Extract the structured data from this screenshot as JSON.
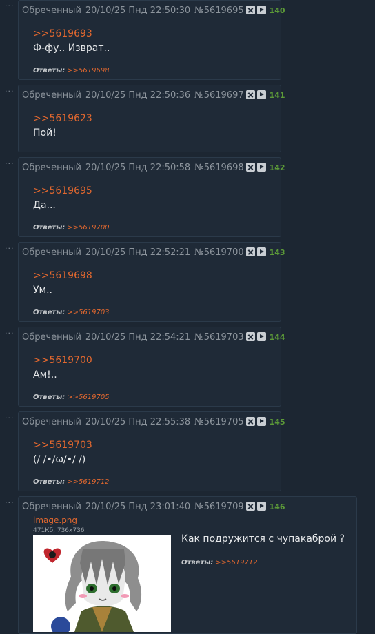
{
  "posts": [
    {
      "author": "Обреченный",
      "datetime": "20/10/25 Пнд 22:50:30",
      "post_no": "№5619695",
      "index": "140",
      "quote": ">>5619693",
      "text": "Ф-фу.. Изврат..",
      "answers_label": "Ответы:",
      "answers": ">>5619698"
    },
    {
      "author": "Обреченный",
      "datetime": "20/10/25 Пнд 22:50:36",
      "post_no": "№5619697",
      "index": "141",
      "quote": ">>5619623",
      "text": "Пой!"
    },
    {
      "author": "Обреченный",
      "datetime": "20/10/25 Пнд 22:50:58",
      "post_no": "№5619698",
      "index": "142",
      "quote": ">>5619695",
      "text": "Да...",
      "answers_label": "Ответы:",
      "answers": ">>5619700"
    },
    {
      "author": "Обреченный",
      "datetime": "20/10/25 Пнд 22:52:21",
      "post_no": "№5619700",
      "index": "143",
      "quote": ">>5619698",
      "text": "Ум..",
      "answers_label": "Ответы:",
      "answers": ">>5619703"
    },
    {
      "author": "Обреченный",
      "datetime": "20/10/25 Пнд 22:54:21",
      "post_no": "№5619703",
      "index": "144",
      "quote": ">>5619700",
      "text": "Ам!..",
      "answers_label": "Ответы:",
      "answers": ">>5619705"
    },
    {
      "author": "Обреченный",
      "datetime": "20/10/25 Пнд 22:55:38",
      "post_no": "№5619705",
      "index": "145",
      "quote": ">>5619703",
      "text": "(/ /•/ω/•/ /)",
      "answers_label": "Ответы:",
      "answers": ">>5619712"
    },
    {
      "author": "Обреченный",
      "datetime": "20/10/25 Пнд 23:01:40",
      "post_no": "№5619709",
      "index": "146",
      "file_name": "image.png",
      "file_meta": "471Кб, 736x736",
      "text": "Как подружится с чупакаброй ?",
      "answers_label": "Ответы:",
      "answers": ">>5619712"
    }
  ],
  "menu_dots": "···",
  "icons": {
    "hide": "close-icon",
    "play": "play-icon"
  },
  "colors": {
    "link": "#e2682f",
    "index": "#5c9a38",
    "post_bg": "#1f2a37",
    "page_bg": "#1c2632"
  }
}
